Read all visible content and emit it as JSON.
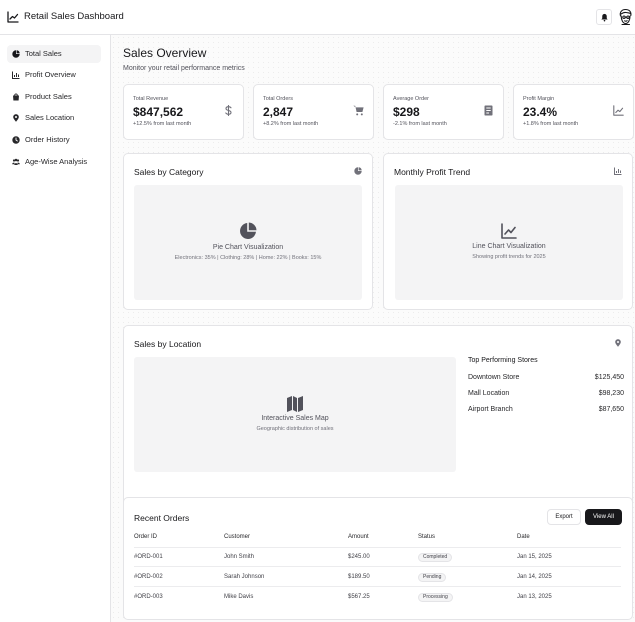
{
  "header": {
    "title": "Retail Sales Dashboard",
    "logo_icon": "trending-chart-icon",
    "notification_icon": "bell-icon"
  },
  "sidebar": {
    "items": [
      {
        "label": "Total Sales",
        "icon": "pie-chart-icon",
        "active": true
      },
      {
        "label": "Profit Overview",
        "icon": "bar-chart-icon",
        "active": false
      },
      {
        "label": "Product Sales",
        "icon": "shopping-bag-icon",
        "active": false
      },
      {
        "label": "Sales Location",
        "icon": "map-pin-icon",
        "active": false
      },
      {
        "label": "Order History",
        "icon": "clock-icon",
        "active": false
      },
      {
        "label": "Age-Wise Analysis",
        "icon": "users-icon",
        "active": false
      }
    ]
  },
  "main": {
    "title": "Sales Overview",
    "subtitle": "Monitor your retail performance metrics",
    "stats": [
      {
        "label": "Total Revenue",
        "value": "$847,562",
        "change": "+12.5% from last month",
        "icon": "dollar-icon"
      },
      {
        "label": "Total Orders",
        "value": "2,847",
        "change": "+8.2% from last month",
        "icon": "cart-icon"
      },
      {
        "label": "Average Order",
        "value": "$298",
        "change": "-2.1% from last month",
        "icon": "receipt-icon"
      },
      {
        "label": "Profit Margin",
        "value": "23.4%",
        "change": "+1.8% from last month",
        "icon": "trend-up-icon"
      }
    ],
    "category_card": {
      "title": "Sales by Category",
      "placeholder_title": "Pie Chart Visualization",
      "placeholder_sub": "Electronics: 35% | Clothing: 28% | Home: 22% | Books: 15%"
    },
    "profit_card": {
      "title": "Monthly Profit Trend",
      "placeholder_title": "Line Chart Visualization",
      "placeholder_sub": "Showing profit trends for 2025"
    },
    "location_card": {
      "title": "Sales by Location",
      "placeholder_title": "Interactive Sales Map",
      "placeholder_sub": "Geographic distribution of sales",
      "stores_title": "Top Performing Stores",
      "stores": [
        {
          "name": "Downtown Store",
          "value": "$125,450"
        },
        {
          "name": "Mall Location",
          "value": "$98,230"
        },
        {
          "name": "Airport Branch",
          "value": "$87,650"
        }
      ]
    },
    "orders": {
      "title": "Recent Orders",
      "export_label": "Export",
      "view_all_label": "View All",
      "columns": [
        "Order ID",
        "Customer",
        "Amount",
        "Status",
        "Date"
      ],
      "rows": [
        {
          "id": "#ORD-001",
          "customer": "John Smith",
          "amount": "$245.00",
          "status": "Completed",
          "date": "Jan 15, 2025"
        },
        {
          "id": "#ORD-002",
          "customer": "Sarah Johnson",
          "amount": "$189.50",
          "status": "Pending",
          "date": "Jan 14, 2025"
        },
        {
          "id": "#ORD-003",
          "customer": "Mike Davis",
          "amount": "$567.25",
          "status": "Processing",
          "date": "Jan 13, 2025"
        }
      ]
    }
  }
}
